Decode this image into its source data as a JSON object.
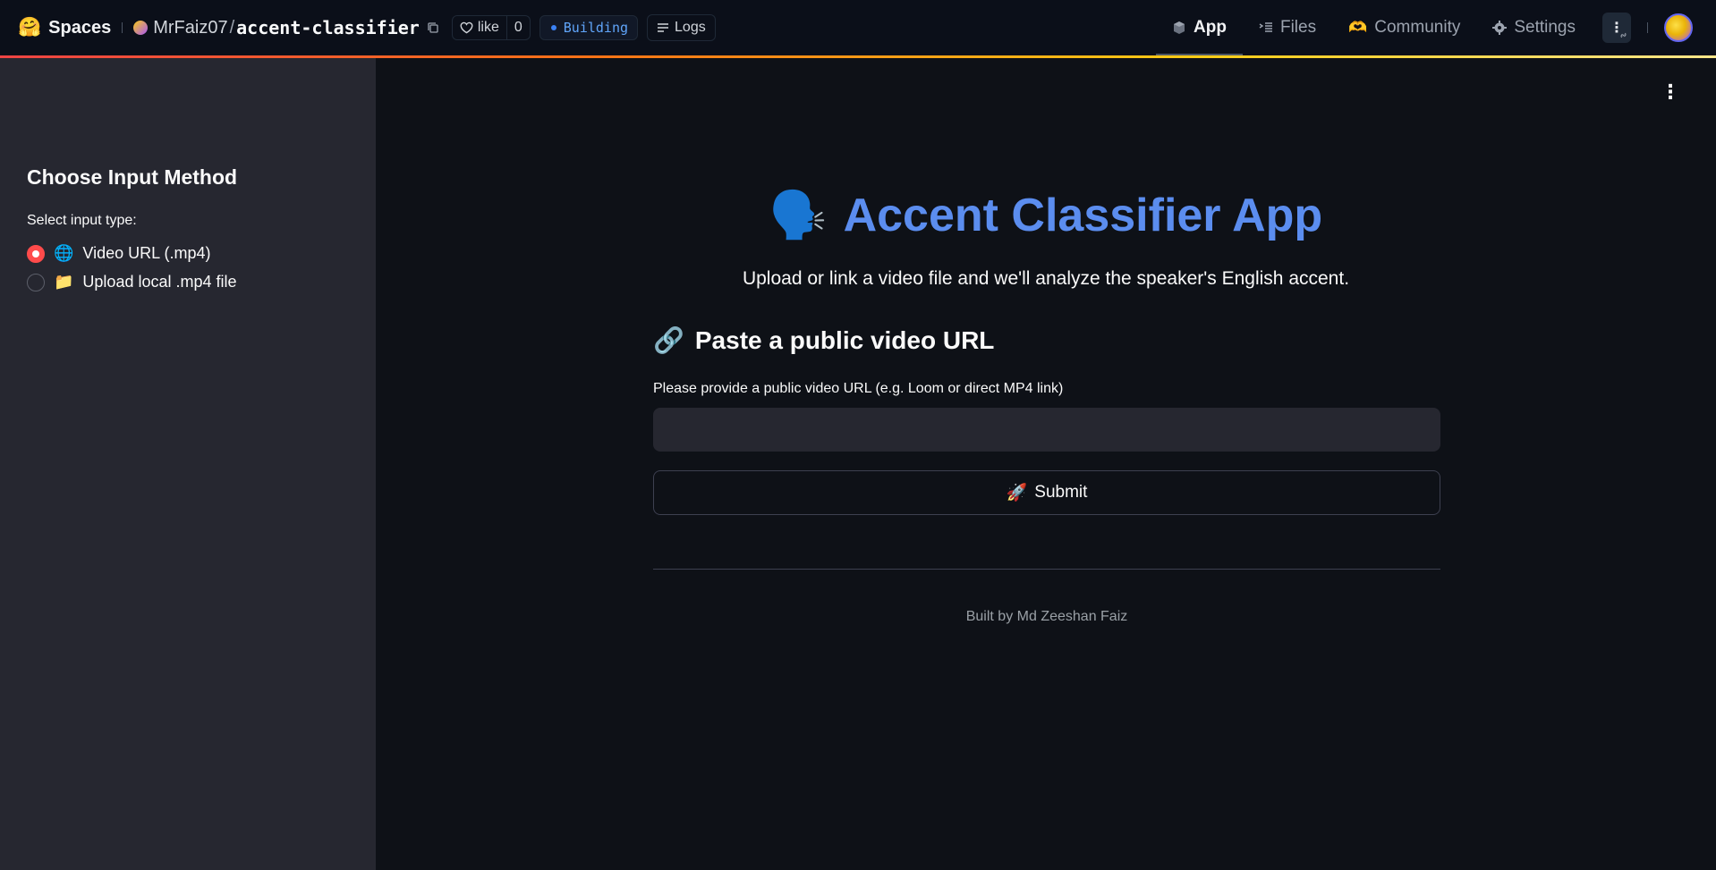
{
  "header": {
    "logo_emoji": "🤗",
    "spaces_label": "Spaces",
    "owner": "MrFaiz07",
    "separator": "/",
    "repo": "accent-classifier",
    "like_label": "like",
    "like_count": "0",
    "status": "Building",
    "logs_label": "Logs",
    "tabs": [
      {
        "label": "App",
        "icon": "cube-icon"
      },
      {
        "label": "Files",
        "icon": "files-icon"
      },
      {
        "label": "Community",
        "icon": "community-icon"
      },
      {
        "label": "Settings",
        "icon": "gear-icon"
      }
    ],
    "more_label": "⋮"
  },
  "sidebar": {
    "title": "Choose Input Method",
    "select_label": "Select input type:",
    "options": [
      {
        "emoji": "🌐",
        "label": "Video URL (.mp4)",
        "checked": true
      },
      {
        "emoji": "📁",
        "label": "Upload local .mp4 file",
        "checked": false
      }
    ]
  },
  "main": {
    "title_emoji": "🗣️",
    "title": "Accent Classifier App",
    "subtitle": "Upload or link a video file and we'll analyze the speaker's English accent.",
    "section_emoji": "🔗",
    "section_title": "Paste a public video URL",
    "field_label": "Please provide a public video URL (e.g. Loom or direct MP4 link)",
    "input_value": "",
    "submit_emoji": "🚀",
    "submit_label": "Submit",
    "footer": "Built by Md Zeeshan Faiz"
  },
  "colors": {
    "accent_title": "#5b8def",
    "radio_checked": "#ff4b4b",
    "sidebar_bg": "#262730",
    "main_bg": "#0e1117",
    "status_blue": "#60a5fa"
  }
}
